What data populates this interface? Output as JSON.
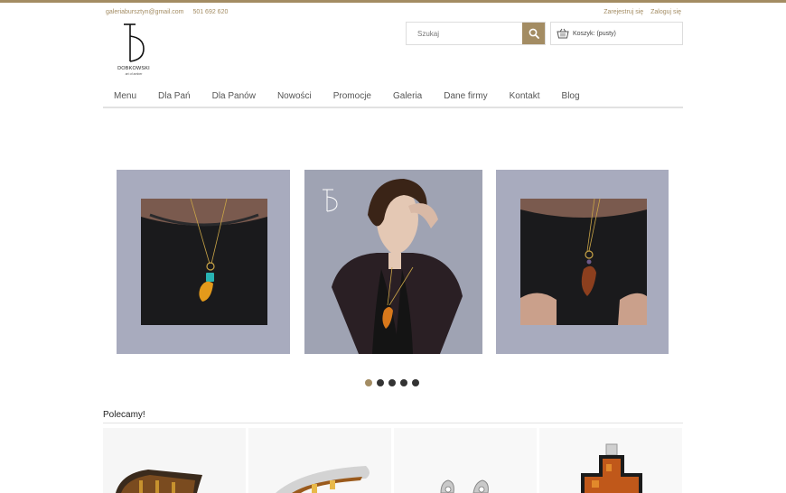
{
  "header": {
    "email": "galeriabursztyn@gmail.com",
    "phone": "501 692 620",
    "register_label": "Zarejestruj się",
    "login_label": "Zaloguj się"
  },
  "logo": {
    "wordmark": "DOBKOWSKI",
    "tagline": "art of amber"
  },
  "search": {
    "placeholder": "Szukaj",
    "icon": "search-icon"
  },
  "cart": {
    "label": "Koszyk:",
    "status": "(pusty)",
    "icon": "basket-icon"
  },
  "nav": {
    "items": [
      {
        "label": "Menu"
      },
      {
        "label": "Dla Pań"
      },
      {
        "label": "Dla Panów"
      },
      {
        "label": "Nowości"
      },
      {
        "label": "Promocje"
      },
      {
        "label": "Galeria"
      },
      {
        "label": "Dane firmy"
      },
      {
        "label": "Kontakt"
      },
      {
        "label": "Blog"
      }
    ]
  },
  "carousel": {
    "slide_count": 5,
    "active_index": 0
  },
  "featured": {
    "title": "Polecamy!"
  },
  "colors": {
    "accent": "#a38c63",
    "slide_background": "#a8abbe",
    "dot_inactive": "#333333"
  }
}
